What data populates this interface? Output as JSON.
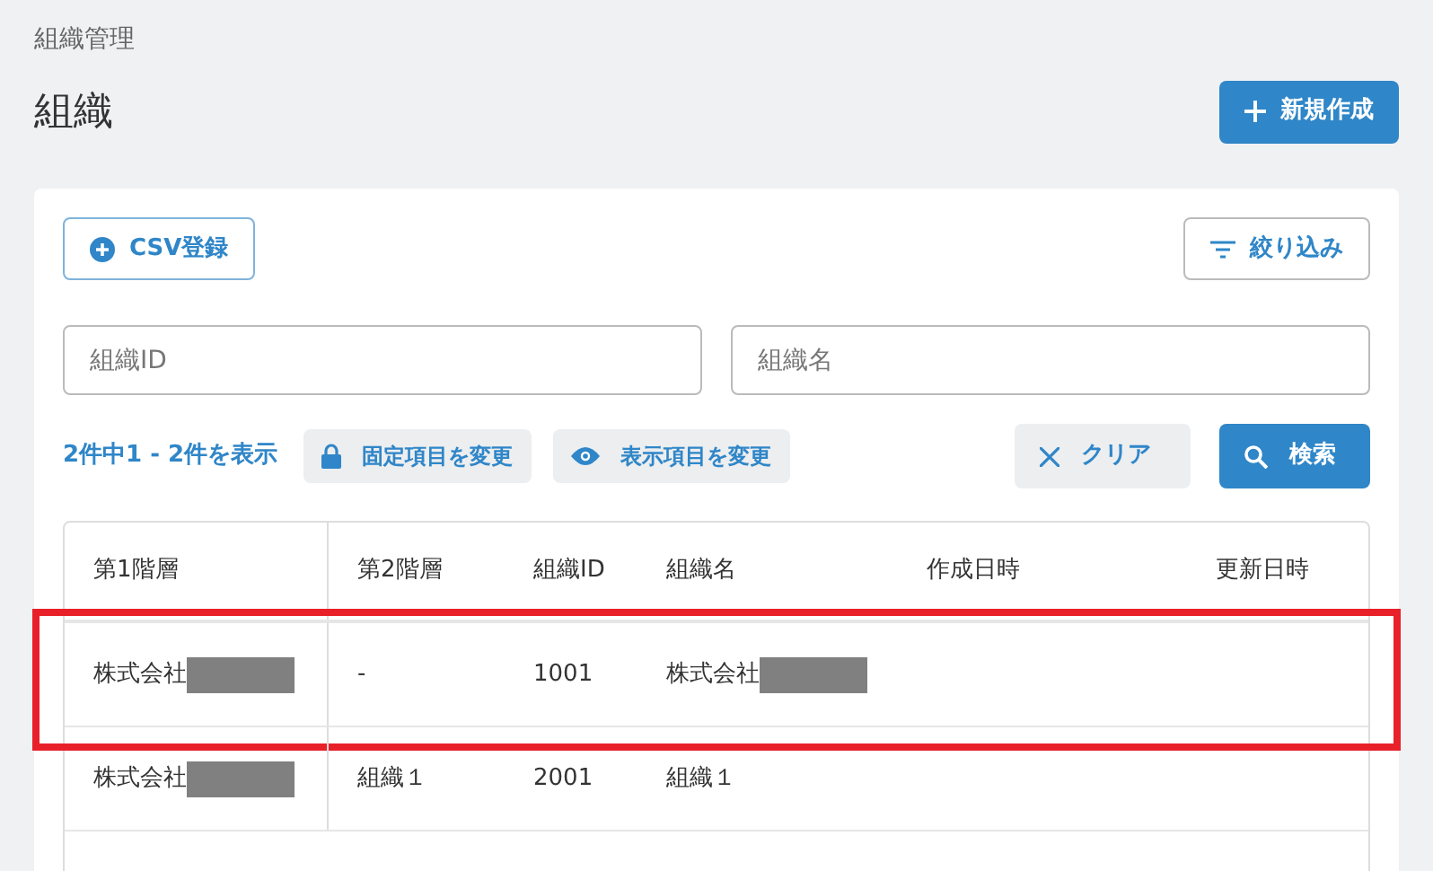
{
  "breadcrumb": "組織管理",
  "title": "組織",
  "new_button": {
    "label": "新規作成"
  },
  "csv_button": {
    "label": "CSV登録"
  },
  "filter_button": {
    "label": "絞り込み"
  },
  "fields": [
    {
      "placeholder": "組織ID"
    },
    {
      "placeholder": "組織名"
    }
  ],
  "result_count": "2件中1 - 2件を表示",
  "toolbar_buttons": [
    {
      "kind": "lock",
      "label": "固定項目を変更"
    },
    {
      "kind": "eye",
      "label": "表示項目を変更"
    }
  ],
  "clear_button": {
    "label": "クリア"
  },
  "search_button": {
    "label": "検索"
  },
  "table": {
    "columns": [
      "第1階層",
      "第2階層",
      "組織ID",
      "組織名",
      "作成日時",
      "更新日時"
    ],
    "rows": [
      {
        "highlighted": true,
        "cells": [
          {
            "text": "株式会社",
            "redacted": true
          },
          {
            "text": "-",
            "redacted": false
          },
          {
            "text": "1001",
            "redacted": false
          },
          {
            "text": "株式会社",
            "redacted": true
          }
        ]
      },
      {
        "highlighted": false,
        "cells": [
          {
            "text": "株式会社",
            "redacted": true
          },
          {
            "text": "組織１",
            "redacted": false
          },
          {
            "text": "2001",
            "redacted": false
          },
          {
            "text": "組織１",
            "redacted": false
          }
        ]
      }
    ]
  }
}
